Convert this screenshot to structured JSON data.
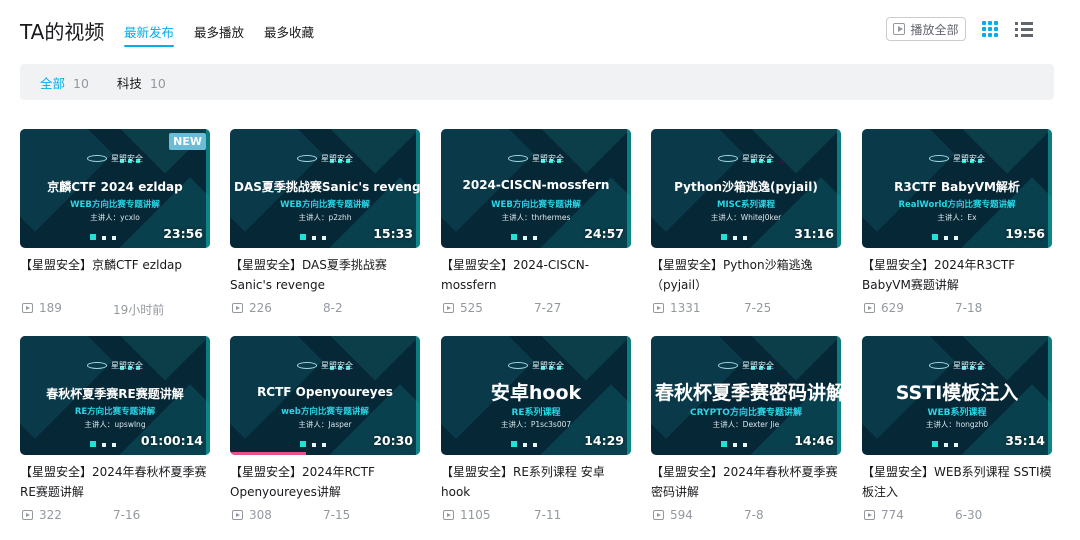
{
  "header": {
    "title": "TA的视频",
    "tabs": [
      {
        "label": "最新发布",
        "active": true
      },
      {
        "label": "最多播放",
        "active": false
      },
      {
        "label": "最多收藏",
        "active": false
      }
    ],
    "play_all_label": "播放全部"
  },
  "filters": [
    {
      "label": "全部",
      "count": "10",
      "active": true
    },
    {
      "label": "科技",
      "count": "10",
      "active": false
    }
  ],
  "colors": {
    "accent": "#00aeec",
    "progress": "#e65487",
    "new_badge": "#6cbbd7"
  },
  "videos": [
    {
      "thumb_title": "京麟CTF 2024 ezldap",
      "thumb_sub": "WEB方向比赛专题讲解",
      "thumb_lecturer": "主讲人：ycxlo",
      "duration": "23:56",
      "title": "【星盟安全】京麟CTF ezldap",
      "plays": "189",
      "date": "19小时前",
      "new": "NEW"
    },
    {
      "thumb_title": "DAS夏季挑战赛Sanic's revenge",
      "thumb_sub": "WEB方向比赛专题讲解",
      "thumb_lecturer": "主讲人：p2zhh",
      "duration": "15:33",
      "title": "【星盟安全】DAS夏季挑战赛Sanic's revenge",
      "plays": "226",
      "date": "8-2"
    },
    {
      "thumb_title": "2024-CISCN-mossfern",
      "thumb_sub": "WEB方向比赛专题讲解",
      "thumb_lecturer": "主讲人：thrhermes",
      "duration": "24:57",
      "title": "【星盟安全】2024-CISCN-mossfern",
      "plays": "525",
      "date": "7-27"
    },
    {
      "thumb_title": "Python沙箱逃逸(pyjail)",
      "thumb_sub": "MISC系列课程",
      "thumb_lecturer": "主讲人：WhiteJ0ker",
      "duration": "31:16",
      "title": "【星盟安全】Python沙箱逃逸（pyjail）",
      "plays": "1331",
      "date": "7-25"
    },
    {
      "thumb_title": "R3CTF BabyVM解析",
      "thumb_sub": "RealWorld方向比赛专题讲解",
      "thumb_lecturer": "主讲人：Ex",
      "duration": "19:56",
      "title": "【星盟安全】2024年R3CTF BabyVM赛题讲解",
      "plays": "629",
      "date": "7-18"
    },
    {
      "thumb_title": "春秋杯夏季赛RE赛题讲解",
      "thumb_sub": "RE方向比赛专题讲解",
      "thumb_lecturer": "主讲人：upswlng",
      "duration": "01:00:14",
      "title": "【星盟安全】2024年春秋杯夏季赛RE赛题讲解",
      "plays": "322",
      "date": "7-16"
    },
    {
      "thumb_title": "RCTF Openyoureyes",
      "thumb_sub": "web方向比赛专题讲解",
      "thumb_lecturer": "主讲人：Jasper",
      "duration": "20:30",
      "title": "【星盟安全】2024年RCTF Openyoureyes讲解",
      "plays": "308",
      "date": "7-15",
      "progress": 0.4
    },
    {
      "thumb_title": "安卓hook",
      "thumb_sub": "RE系列课程",
      "thumb_lecturer": "主讲人：P1sc3s007",
      "duration": "14:29",
      "title": "【星盟安全】RE系列课程 安卓hook",
      "plays": "1105",
      "date": "7-11"
    },
    {
      "thumb_title": "春秋杯夏季赛密码讲解",
      "thumb_sub": "CRYPTO方向比赛专题讲解",
      "thumb_lecturer": "主讲人：Dexter Jie",
      "duration": "14:46",
      "title": "【星盟安全】2024年春秋杯夏季赛密码讲解",
      "plays": "594",
      "date": "7-8"
    },
    {
      "thumb_title": "SSTI模板注入",
      "thumb_sub": "WEB系列课程",
      "thumb_lecturer": "主讲人：hongzh0",
      "duration": "35:14",
      "title": "【星盟安全】WEB系列课程 SSTI模板注入",
      "plays": "774",
      "date": "6-30"
    }
  ],
  "thumb_brand": "星盟安全"
}
